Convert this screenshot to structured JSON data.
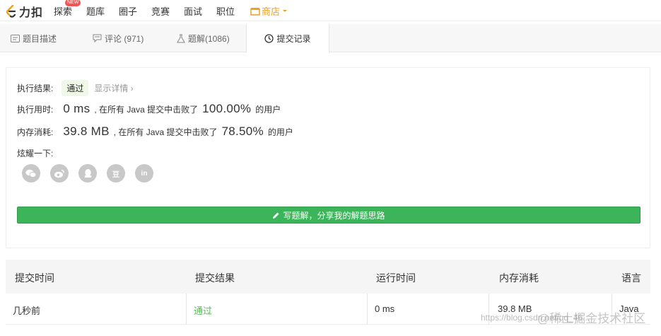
{
  "nav": {
    "logo_text": "力扣",
    "items": [
      "探索",
      "题库",
      "圈子",
      "竞赛",
      "面试",
      "职位"
    ],
    "new_badge": "NEW",
    "shop_label": "商店",
    "brand_color": "#f0a020"
  },
  "tabs": [
    {
      "label": "题目描述",
      "icon": "description-icon"
    },
    {
      "label": "评论 (971)",
      "icon": "comment-icon"
    },
    {
      "label": "题解(1086)",
      "icon": "flask-icon"
    },
    {
      "label": "提交记录",
      "icon": "clock-icon",
      "active": true
    }
  ],
  "result": {
    "status_label": "执行结果:",
    "status_value": "通过",
    "detail_link": "显示详情 ›",
    "runtime_label": "执行用时:",
    "runtime_value": "0 ms",
    "runtime_mid": ", 在所有 Java 提交中击败了",
    "runtime_percent": "100.00%",
    "runtime_tail": "的用户",
    "memory_label": "内存消耗:",
    "memory_value": "39.8 MB",
    "memory_mid": ", 在所有 Java 提交中击败了",
    "memory_percent": "78.50%",
    "memory_tail": "的用户",
    "share_label": "炫耀一下:",
    "share_icons": [
      "wechat-icon",
      "weibo-icon",
      "qq-icon",
      "douban-icon",
      "linkedin-icon"
    ],
    "douban_glyph": "豆",
    "linkedin_glyph": "in",
    "write_button": "写题解，分享我的解题思路",
    "accent_color": "#3cb55a"
  },
  "table": {
    "headers": [
      "提交时间",
      "提交结果",
      "运行时间",
      "内存消耗",
      "语言"
    ],
    "rows": [
      [
        "几秒前",
        "通过",
        "0 ms",
        "39.8 MB",
        "Java"
      ]
    ]
  },
  "watermark": {
    "url": "https://blog.csdn.net/qq_46...",
    "brand": "@稀土掘金技术社区"
  }
}
